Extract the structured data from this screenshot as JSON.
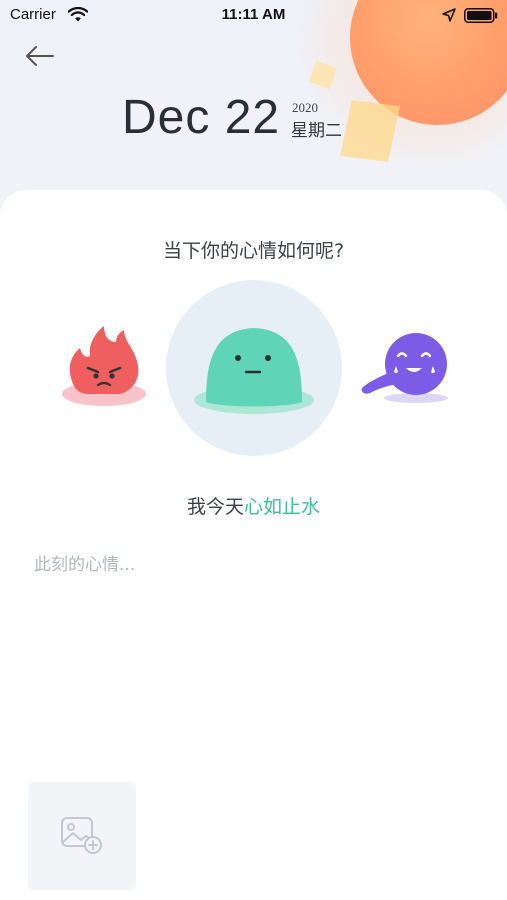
{
  "status_bar": {
    "carrier": "Carrier",
    "time": "11:11 AM",
    "icons": [
      "wifi-icon",
      "location-icon",
      "battery-icon"
    ]
  },
  "header": {
    "back_icon": "arrow-left-icon",
    "date": "Dec 22",
    "year": "2020",
    "weekday": "星期二"
  },
  "mood": {
    "question": "当下你的心情如何呢?",
    "options": [
      {
        "name": "angry",
        "icon": "angry-fire-face-icon",
        "color": "#ef5f5f",
        "selected": false
      },
      {
        "name": "calm",
        "icon": "calm-blob-face-icon",
        "color": "#5fd4b6",
        "selected": true
      },
      {
        "name": "happy",
        "icon": "happy-ghost-face-icon",
        "color": "#7c5ce6",
        "selected": false
      }
    ],
    "caption_prefix": "我今天",
    "caption_highlight": "心如止水"
  },
  "note": {
    "placeholder": "此刻的心情...",
    "value": ""
  },
  "photo": {
    "icon": "add-image-icon"
  },
  "colors": {
    "accent": "#3bbf95",
    "sun": "#ff9d6a"
  }
}
